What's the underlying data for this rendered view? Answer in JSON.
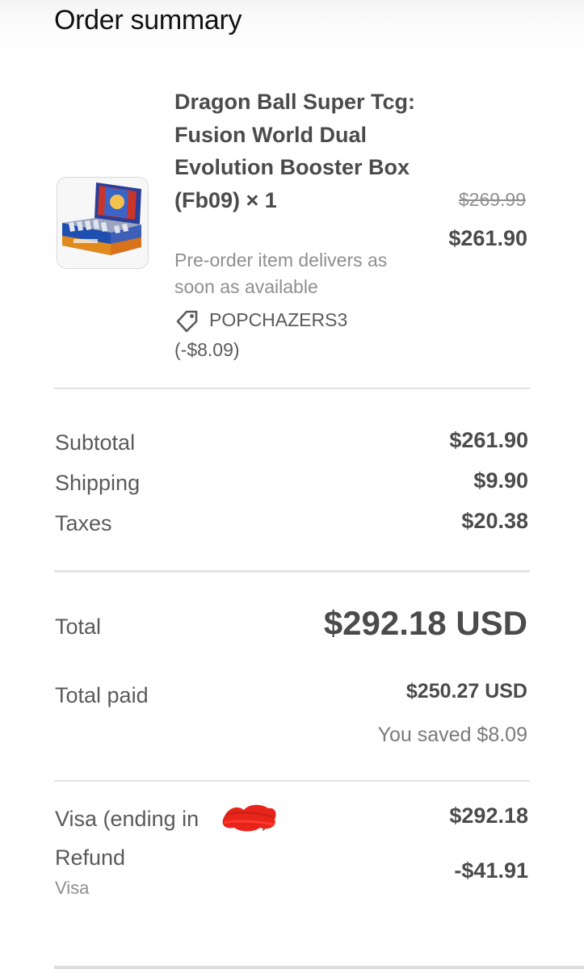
{
  "header": {
    "title": "Order summary"
  },
  "item": {
    "name": "Dragon Ball Super Tcg: Fusion World Dual Evolution Booster Box (Fb09) × 1",
    "note": "Pre-order item delivers as soon as available",
    "discount_code": "POPCHAZERS3 (-$8.09)",
    "original_price": "$269.99",
    "price": "$261.90",
    "image_icon": "booster-box-thumbnail"
  },
  "costs": {
    "subtotal_label": "Subtotal",
    "subtotal_value": "$261.90",
    "shipping_label": "Shipping",
    "shipping_value": "$9.90",
    "taxes_label": "Taxes",
    "taxes_value": "$20.38"
  },
  "totals": {
    "total_label": "Total",
    "total_value": "$292.18 USD",
    "paid_label": "Total paid",
    "paid_value": "$250.27 USD",
    "saved_text": "You saved $8.09"
  },
  "payments": {
    "visa_label": "Visa (ending in",
    "visa_label_end": ")",
    "visa_value": "$292.18",
    "refund_label": "Refund",
    "refund_method": "Visa",
    "refund_value": "-$41.91"
  },
  "colors": {
    "text_primary": "#4b4b4b",
    "text_muted": "#8f8f8f",
    "redaction": "#e8251b"
  }
}
